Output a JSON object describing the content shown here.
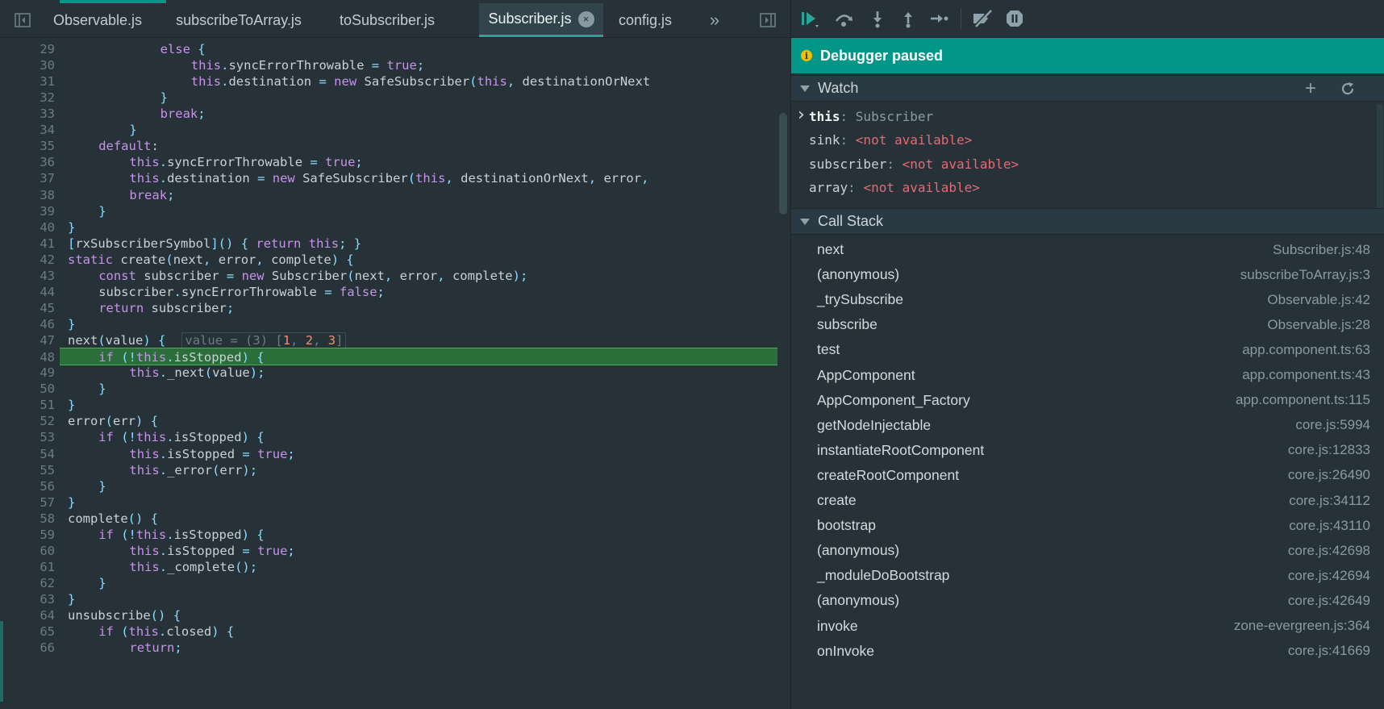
{
  "editor": {
    "tabs": [
      {
        "label": "Observable.js",
        "active": false
      },
      {
        "label": "subscribeToArray.js",
        "active": false
      },
      {
        "label": "toSubscriber.js",
        "active": false
      },
      {
        "label": "Subscriber.js",
        "active": true
      },
      {
        "label": "config.js",
        "active": false
      }
    ],
    "overflow_label": "»",
    "active_tab_close": "×",
    "highlighted_line": 48,
    "inline_value": "value = (3) [1, 2, 3]",
    "lines": [
      {
        "n": "29",
        "indent": 12,
        "text": "else {"
      },
      {
        "n": "30",
        "indent": 16,
        "text": "this.syncErrorThrowable = true;"
      },
      {
        "n": "31",
        "indent": 16,
        "text": "this.destination = new SafeSubscriber(this, destinationOrNext"
      },
      {
        "n": "32",
        "indent": 12,
        "text": "}"
      },
      {
        "n": "33",
        "indent": 12,
        "text": "break;"
      },
      {
        "n": "34",
        "indent": 8,
        "text": "}"
      },
      {
        "n": "35",
        "indent": 4,
        "text": "default:"
      },
      {
        "n": "36",
        "indent": 8,
        "text": "this.syncErrorThrowable = true;"
      },
      {
        "n": "37",
        "indent": 8,
        "text": "this.destination = new SafeSubscriber(this, destinationOrNext, error,"
      },
      {
        "n": "38",
        "indent": 8,
        "text": "break;"
      },
      {
        "n": "39",
        "indent": 4,
        "text": "}"
      },
      {
        "n": "40",
        "indent": 0,
        "text": "}"
      },
      {
        "n": "41",
        "indent": 0,
        "text": "[rxSubscriberSymbol]() { return this; }"
      },
      {
        "n": "42",
        "indent": 0,
        "text": "static create(next, error, complete) {"
      },
      {
        "n": "43",
        "indent": 4,
        "text": "const subscriber = new Subscriber(next, error, complete);"
      },
      {
        "n": "44",
        "indent": 4,
        "text": "subscriber.syncErrorThrowable = false;"
      },
      {
        "n": "45",
        "indent": 4,
        "text": "return subscriber;"
      },
      {
        "n": "46",
        "indent": 0,
        "text": "}"
      },
      {
        "n": "47",
        "indent": 0,
        "text": "next(value) {"
      },
      {
        "n": "48",
        "indent": 4,
        "text": "if (!this.isStopped) {"
      },
      {
        "n": "49",
        "indent": 8,
        "text": "this._next(value);"
      },
      {
        "n": "50",
        "indent": 4,
        "text": "}"
      },
      {
        "n": "51",
        "indent": 0,
        "text": "}"
      },
      {
        "n": "52",
        "indent": 0,
        "text": "error(err) {"
      },
      {
        "n": "53",
        "indent": 4,
        "text": "if (!this.isStopped) {"
      },
      {
        "n": "54",
        "indent": 8,
        "text": "this.isStopped = true;"
      },
      {
        "n": "55",
        "indent": 8,
        "text": "this._error(err);"
      },
      {
        "n": "56",
        "indent": 4,
        "text": "}"
      },
      {
        "n": "57",
        "indent": 0,
        "text": "}"
      },
      {
        "n": "58",
        "indent": 0,
        "text": "complete() {"
      },
      {
        "n": "59",
        "indent": 4,
        "text": "if (!this.isStopped) {"
      },
      {
        "n": "60",
        "indent": 8,
        "text": "this.isStopped = true;"
      },
      {
        "n": "61",
        "indent": 8,
        "text": "this._complete();"
      },
      {
        "n": "62",
        "indent": 4,
        "text": "}"
      },
      {
        "n": "63",
        "indent": 0,
        "text": "}"
      },
      {
        "n": "64",
        "indent": 0,
        "text": "unsubscribe() {"
      },
      {
        "n": "65",
        "indent": 4,
        "text": "if (this.closed) {"
      },
      {
        "n": "66",
        "indent": 8,
        "text": "return;"
      }
    ]
  },
  "debugger": {
    "status": "Debugger paused",
    "status_icon": "i",
    "toolbar_icons": [
      "resume-icon",
      "step-over-icon",
      "step-into-icon",
      "step-out-icon",
      "step-icon",
      "deactivate-breakpoints-icon",
      "pause-on-exceptions-icon"
    ],
    "watch": {
      "title": "Watch",
      "items": [
        {
          "name": "this",
          "value": "Subscriber",
          "expandable": true,
          "available": true
        },
        {
          "name": "sink",
          "value": "<not available>",
          "expandable": false,
          "available": false
        },
        {
          "name": "subscriber",
          "value": "<not available>",
          "expandable": false,
          "available": false
        },
        {
          "name": "array",
          "value": "<not available>",
          "expandable": false,
          "available": false
        }
      ]
    },
    "call_stack": {
      "title": "Call Stack",
      "frames": [
        {
          "fn": "next",
          "loc": "Subscriber.js:48"
        },
        {
          "fn": "(anonymous)",
          "loc": "subscribeToArray.js:3"
        },
        {
          "fn": "_trySubscribe",
          "loc": "Observable.js:42"
        },
        {
          "fn": "subscribe",
          "loc": "Observable.js:28"
        },
        {
          "fn": "test",
          "loc": "app.component.ts:63"
        },
        {
          "fn": "AppComponent",
          "loc": "app.component.ts:43"
        },
        {
          "fn": "AppComponent_Factory",
          "loc": "app.component.ts:115"
        },
        {
          "fn": "getNodeInjectable",
          "loc": "core.js:5994"
        },
        {
          "fn": "instantiateRootComponent",
          "loc": "core.js:12833"
        },
        {
          "fn": "createRootComponent",
          "loc": "core.js:26490"
        },
        {
          "fn": "create",
          "loc": "core.js:34112"
        },
        {
          "fn": "bootstrap",
          "loc": "core.js:43110"
        },
        {
          "fn": "(anonymous)",
          "loc": "core.js:42698"
        },
        {
          "fn": "_moduleDoBootstrap",
          "loc": "core.js:42694"
        },
        {
          "fn": "(anonymous)",
          "loc": "core.js:42649"
        },
        {
          "fn": "invoke",
          "loc": "zone-evergreen.js:364"
        },
        {
          "fn": "onInvoke",
          "loc": "core.js:41669"
        }
      ]
    }
  },
  "colors": {
    "accent": "#009688",
    "highlight_line": "#2b6e3a",
    "keyword": "#c792ea",
    "number": "#f78c6c",
    "not_available": "#e06c75"
  }
}
